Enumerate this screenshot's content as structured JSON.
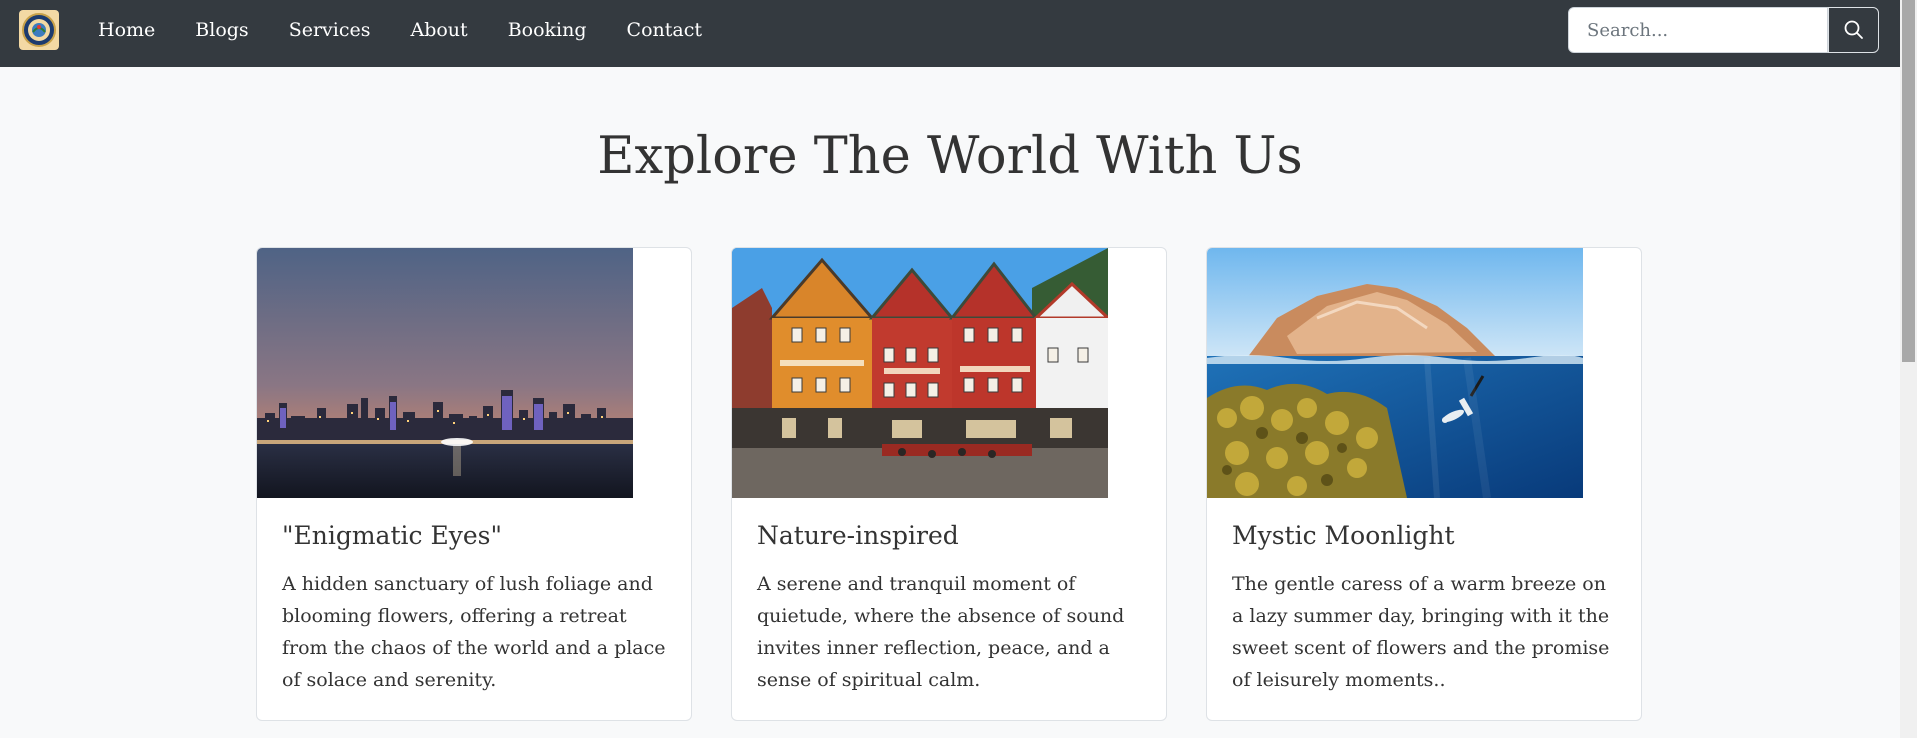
{
  "nav": {
    "links": [
      "Home",
      "Blogs",
      "Services",
      "About",
      "Booking",
      "Contact"
    ],
    "search_placeholder": "Search...",
    "logo_icon": "travel-logo-icon",
    "search_icon": "search-icon",
    "bg_color": "#343a40"
  },
  "hero": {
    "title": "Explore The World With Us"
  },
  "cards": [
    {
      "title": "\"Enigmatic Eyes\"",
      "text": "A hidden sanctuary of lush foliage and blooming flowers, offering a retreat from the chaos of the world and a place of solace and serenity."
    },
    {
      "title": "Nature-inspired",
      "text": "A serene and tranquil moment of quietude, where the absence of sound invites inner reflection, peace, and a sense of spiritual calm."
    },
    {
      "title": "Mystic Moonlight",
      "text": "The gentle caress of a warm breeze on a lazy summer day, bringing with it the sweet scent of flowers and the promise of leisurely moments.."
    }
  ]
}
